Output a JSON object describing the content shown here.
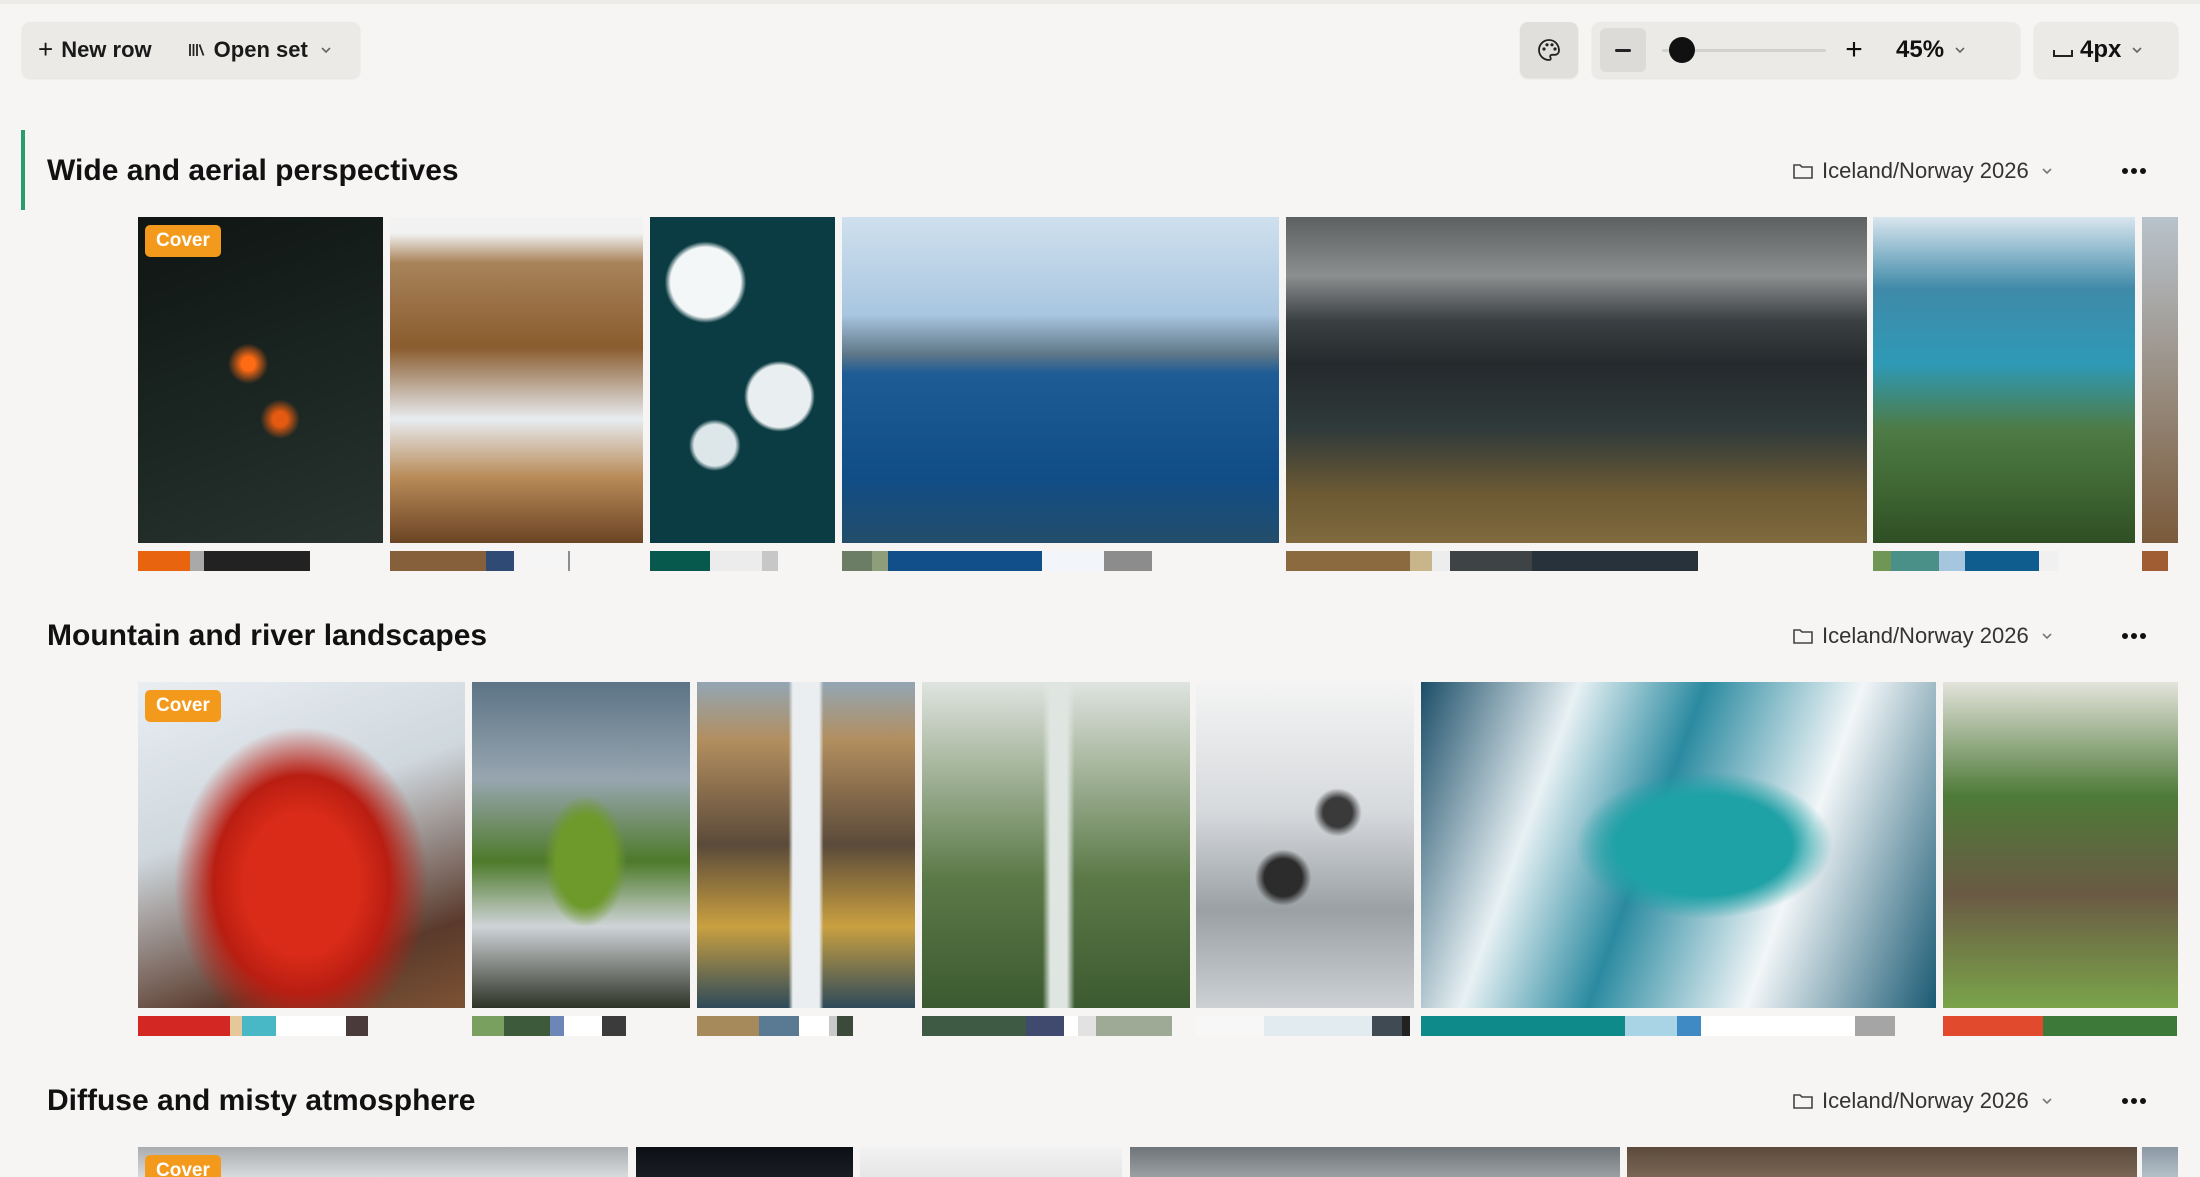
{
  "toolbar": {
    "new_row_label": "New row",
    "open_set_label": "Open set",
    "palette_icon": "palette-icon",
    "zoom_level": 0.05,
    "zoom_label": "45%",
    "gap_label": "4px"
  },
  "sections": [
    {
      "title": "Wide and aerial perspectives",
      "folder": "Iceland/Norway 2026",
      "cover_label": "Cover",
      "tiles": [
        {
          "alt": "lava flow aerial",
          "bg": "radial-gradient(circle at 45% 45%, #ff6a14 0 3%, transparent 9%), radial-gradient(circle at 58% 62%, #e35a10 0 3%, transparent 8%), linear-gradient(160deg,#0f1513,#1b2622 55%,#283330)",
          "swatches": [
            {
              "c": "#e8640e",
              "w": 52
            },
            {
              "c": "#a9a9a9",
              "w": 14
            },
            {
              "c": "#222222",
              "w": 106
            }
          ]
        },
        {
          "alt": "waterfall canyon snow",
          "bg": "linear-gradient(180deg,#f2f2f2 0 5%,#a8835a 14%,#8a5c2e 40%,#e8ecf0 62%,#b88a57 80%,#6b4424)",
          "swatches": [
            {
              "c": "#86603a",
              "w": 96
            },
            {
              "c": "#2f4a74",
              "w": 28
            },
            {
              "c": "#f5f5f5",
              "w": 54
            },
            {
              "c": "#8e8e8e",
              "w": 2
            }
          ]
        },
        {
          "alt": "ice floes on dark water",
          "bg": "radial-gradient(circle at 30% 20%,#f3f7f8 0 12%,transparent 14%), radial-gradient(circle at 70% 55%,#e9eef0 0 14%,transparent 16%), radial-gradient(circle at 35% 70%,#dde7ea 0 8%,transparent 10%), linear-gradient(#0b3c43,#0b3c43)",
          "swatches": [
            {
              "c": "#07584d",
              "w": 60
            },
            {
              "c": "#ececec",
              "w": 52
            },
            {
              "c": "#c7c7c7",
              "w": 16
            }
          ]
        },
        {
          "alt": "ocean road bridge",
          "bg": "linear-gradient(180deg,#cfe0ee 0%,#a9c6e0 30%,#5f7788 42%,#1e5c96 48%,#104d87 80%,#234d6a)",
          "swatches": [
            {
              "c": "#6b7e65",
              "w": 30
            },
            {
              "c": "#8e9d7a",
              "w": 16
            },
            {
              "c": "#104f8a",
              "w": 154
            },
            {
              "c": "#f2f6fa",
              "w": 62
            },
            {
              "c": "#8c8c8c",
              "w": 48
            }
          ]
        },
        {
          "alt": "road through lagoon mountains",
          "bg": "linear-gradient(180deg,#5d6061 0%,#8c8f90 18%,#3a3f42 32%,#252a2d 45%,#2f3a3a 65%,#6d5a34 85%,#806a3e)",
          "swatches": [
            {
              "c": "#8a6a3e",
              "w": 124
            },
            {
              "c": "#c9b58a",
              "w": 22
            },
            {
              "c": "#ededed",
              "w": 18
            },
            {
              "c": "#3e4446",
              "w": 82
            },
            {
              "c": "#27323a",
              "w": 166
            }
          ]
        },
        {
          "alt": "fjord islands",
          "bg": "linear-gradient(180deg,#d9e6ef 0%,#3f8aa8 22%,#2e9ab6 45%,#4e7b46 65%,#3d6431 85%,#2f4e24)",
          "swatches": [
            {
              "c": "#6f9654",
              "w": 18
            },
            {
              "c": "#4a8f88",
              "w": 48
            },
            {
              "c": "#a6c6df",
              "w": 26
            },
            {
              "c": "#0f5d8e",
              "w": 74
            },
            {
              "c": "#f0f0f0",
              "w": 20
            }
          ]
        },
        {
          "alt": "coastal town partial",
          "bg": "linear-gradient(180deg,#b8c3cc,#7a5a3a)",
          "swatches": [
            {
              "c": "#a05c33",
              "w": 26
            }
          ]
        }
      ]
    },
    {
      "title": "Mountain and river landscapes",
      "folder": "Iceland/Norway 2026",
      "cover_label": "Cover",
      "tiles": [
        {
          "alt": "red river delta glacier",
          "bg": "radial-gradient(ellipse at 50% 62%, #d92b18 0 25%, #b91e12 38%, transparent 55%), linear-gradient(160deg,#e9eef2 0%,#cfd8de 40%,#5a3a2c 80%,#7c5233)",
          "swatches": [
            {
              "c": "#d22722",
              "w": 92
            },
            {
              "c": "#e5c79a",
              "w": 12
            },
            {
              "c": "#48b8c7",
              "w": 34
            },
            {
              "c": "#ffffff",
              "w": 70
            },
            {
              "c": "#4a3a3a",
              "w": 22
            }
          ]
        },
        {
          "alt": "green mountain with falls",
          "bg": "radial-gradient(ellipse at 52% 55%,#6e9a2c 0 18%,transparent 26%), linear-gradient(180deg,#5c7486 0%,#98a6b0 30%,#4e7a2a 55%,#cfd4d8 75%,#2e3326)",
          "swatches": [
            {
              "c": "#7aa060",
              "w": 32
            },
            {
              "c": "#3d5a3a",
              "w": 46
            },
            {
              "c": "#6c86b8",
              "w": 14
            },
            {
              "c": "#ffffff",
              "w": 38
            },
            {
              "c": "#3b3b3b",
              "w": 24
            }
          ]
        },
        {
          "alt": "tall waterfall cliffs",
          "bg": "linear-gradient(90deg,transparent 0 42%,#eaeef0 44% 56%,transparent 58%), linear-gradient(180deg,#93a6b4 0%,#b28e5e 18%,#5b4a3a 50%,#c9a040 75%,#2e4a5a)",
          "swatches": [
            {
              "c": "#a68a5c",
              "w": 62
            },
            {
              "c": "#5a7a93",
              "w": 40
            },
            {
              "c": "#ffffff",
              "w": 30
            },
            {
              "c": "#c9c9c9",
              "w": 8
            },
            {
              "c": "#3c4a3c",
              "w": 16
            }
          ]
        },
        {
          "alt": "misty green gorge",
          "bg": "linear-gradient(90deg,transparent 0 45%,#dfe6e2 48% 54%,transparent 57%), linear-gradient(180deg,#dfe4e0 0%,#a9b8a0 25%,#5c7a48 60%,#3b5a30)",
          "swatches": [
            {
              "c": "#3f5a44",
              "w": 104
            },
            {
              "c": "#3f4a6e",
              "w": 38
            },
            {
              "c": "#ffffff",
              "w": 14
            },
            {
              "c": "#e2e2e2",
              "w": 18
            },
            {
              "c": "#9eaa96",
              "w": 76
            }
          ]
        },
        {
          "alt": "black and white glacier",
          "bg": "radial-gradient(circle at 40% 60%,#2c2c2c 0 8%,transparent 12%), radial-gradient(circle at 65% 40%,#3a3a3a 0 6%,transparent 10%), linear-gradient(180deg,#f4f4f4 0%,#d6d9dc 40%,#9aa0a4 70%,#cdd1d4)",
          "swatches": [
            {
              "c": "#f7f7f7",
              "w": 68
            },
            {
              "c": "#e2ecf0",
              "w": 108
            },
            {
              "c": "#3f4a52",
              "w": 30
            },
            {
              "c": "#222222",
              "w": 8
            }
          ]
        },
        {
          "alt": "turquoise glacial river",
          "bg": "radial-gradient(ellipse at 55% 50%,#1fa2a6 0 22%,transparent 32%), linear-gradient(110deg,#1c4e68 0%,#e8f1f4 25%,#2a8aa0 45%,#f2f6f8 70%,#1a5a73)",
          "swatches": [
            {
              "c": "#0f8a8a",
              "w": 204
            },
            {
              "c": "#a8d4e6",
              "w": 52
            },
            {
              "c": "#3f8ac4",
              "w": 24
            },
            {
              "c": "#ffffff",
              "w": 154
            },
            {
              "c": "#a5a5a5",
              "w": 40
            }
          ]
        },
        {
          "alt": "village with bridge partial",
          "bg": "linear-gradient(180deg,#e4e4dc 0%,#4e7a38 35%,#6a5a44 65%,#7aa44a)",
          "swatches": [
            {
              "c": "#e24a2e",
              "w": 100
            },
            {
              "c": "#3d7a3a",
              "w": 134
            }
          ]
        }
      ]
    },
    {
      "title": "Diffuse and misty atmosphere",
      "folder": "Iceland/Norway 2026",
      "cover_label": "Cover",
      "tiles": [
        {
          "alt": "misty view",
          "bg": "linear-gradient(180deg,#a9adb0,#d8dadc)",
          "swatches": []
        },
        {
          "alt": "dark night",
          "bg": "linear-gradient(180deg,#0c0f14,#1a1e24)",
          "swatches": []
        },
        {
          "alt": "white haze",
          "bg": "linear-gradient(180deg,#f2f2f2,#e6e6e6)",
          "swatches": []
        },
        {
          "alt": "grey sky",
          "bg": "linear-gradient(180deg,#6f7478,#9ba0a3)",
          "swatches": []
        },
        {
          "alt": "brown dusk",
          "bg": "linear-gradient(180deg,#5b4a3c,#7b6654)",
          "swatches": []
        },
        {
          "alt": "blue fog partial",
          "bg": "linear-gradient(180deg,#8a98a4,#b5c0c8)",
          "swatches": []
        }
      ]
    }
  ]
}
